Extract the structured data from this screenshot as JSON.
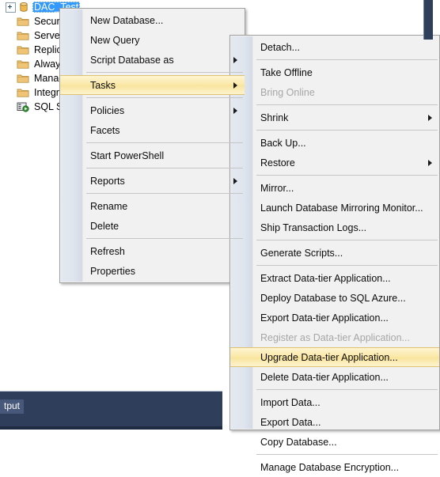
{
  "tree": {
    "items": [
      {
        "label": "DAC_Test",
        "icon": "database-icon",
        "selected": true,
        "expandable": true
      },
      {
        "label": "Security",
        "icon": "folder-icon",
        "selected": false,
        "expandable": false
      },
      {
        "label": "Server Ob",
        "icon": "folder-icon",
        "selected": false,
        "expandable": false
      },
      {
        "label": "Replicatio",
        "icon": "folder-icon",
        "selected": false,
        "expandable": false
      },
      {
        "label": "AlwaysO",
        "icon": "folder-icon",
        "selected": false,
        "expandable": false
      },
      {
        "label": "Manager",
        "icon": "folder-icon",
        "selected": false,
        "expandable": false
      },
      {
        "label": "Integratio",
        "icon": "folder-icon",
        "selected": false,
        "expandable": false
      },
      {
        "label": "SQL Serv",
        "icon": "sql-server-agent-icon",
        "selected": false,
        "expandable": false
      }
    ]
  },
  "context_menu": {
    "items": [
      {
        "type": "item",
        "label": "New Database...",
        "submenu": false,
        "disabled": false,
        "highlighted": false
      },
      {
        "type": "item",
        "label": "New Query",
        "submenu": false,
        "disabled": false,
        "highlighted": false
      },
      {
        "type": "item",
        "label": "Script Database as",
        "submenu": true,
        "disabled": false,
        "highlighted": false
      },
      {
        "type": "separator"
      },
      {
        "type": "item",
        "label": "Tasks",
        "submenu": true,
        "disabled": false,
        "highlighted": true
      },
      {
        "type": "separator"
      },
      {
        "type": "item",
        "label": "Policies",
        "submenu": true,
        "disabled": false,
        "highlighted": false
      },
      {
        "type": "item",
        "label": "Facets",
        "submenu": false,
        "disabled": false,
        "highlighted": false
      },
      {
        "type": "separator"
      },
      {
        "type": "item",
        "label": "Start PowerShell",
        "submenu": false,
        "disabled": false,
        "highlighted": false
      },
      {
        "type": "separator"
      },
      {
        "type": "item",
        "label": "Reports",
        "submenu": true,
        "disabled": false,
        "highlighted": false
      },
      {
        "type": "separator"
      },
      {
        "type": "item",
        "label": "Rename",
        "submenu": false,
        "disabled": false,
        "highlighted": false
      },
      {
        "type": "item",
        "label": "Delete",
        "submenu": false,
        "disabled": false,
        "highlighted": false
      },
      {
        "type": "separator"
      },
      {
        "type": "item",
        "label": "Refresh",
        "submenu": false,
        "disabled": false,
        "highlighted": false
      },
      {
        "type": "item",
        "label": "Properties",
        "submenu": false,
        "disabled": false,
        "highlighted": false
      }
    ]
  },
  "tasks_submenu": {
    "items": [
      {
        "type": "item",
        "label": "Detach...",
        "submenu": false,
        "disabled": false,
        "highlighted": false
      },
      {
        "type": "separator"
      },
      {
        "type": "item",
        "label": "Take Offline",
        "submenu": false,
        "disabled": false,
        "highlighted": false
      },
      {
        "type": "item",
        "label": "Bring Online",
        "submenu": false,
        "disabled": true,
        "highlighted": false
      },
      {
        "type": "separator"
      },
      {
        "type": "item",
        "label": "Shrink",
        "submenu": true,
        "disabled": false,
        "highlighted": false
      },
      {
        "type": "separator"
      },
      {
        "type": "item",
        "label": "Back Up...",
        "submenu": false,
        "disabled": false,
        "highlighted": false
      },
      {
        "type": "item",
        "label": "Restore",
        "submenu": true,
        "disabled": false,
        "highlighted": false
      },
      {
        "type": "separator"
      },
      {
        "type": "item",
        "label": "Mirror...",
        "submenu": false,
        "disabled": false,
        "highlighted": false
      },
      {
        "type": "item",
        "label": "Launch Database Mirroring Monitor...",
        "submenu": false,
        "disabled": false,
        "highlighted": false
      },
      {
        "type": "item",
        "label": "Ship Transaction Logs...",
        "submenu": false,
        "disabled": false,
        "highlighted": false
      },
      {
        "type": "separator"
      },
      {
        "type": "item",
        "label": "Generate Scripts...",
        "submenu": false,
        "disabled": false,
        "highlighted": false
      },
      {
        "type": "separator"
      },
      {
        "type": "item",
        "label": "Extract Data-tier Application...",
        "submenu": false,
        "disabled": false,
        "highlighted": false
      },
      {
        "type": "item",
        "label": "Deploy Database to SQL Azure...",
        "submenu": false,
        "disabled": false,
        "highlighted": false
      },
      {
        "type": "item",
        "label": "Export Data-tier Application...",
        "submenu": false,
        "disabled": false,
        "highlighted": false
      },
      {
        "type": "item",
        "label": "Register as Data-tier Application...",
        "submenu": false,
        "disabled": true,
        "highlighted": false
      },
      {
        "type": "item",
        "label": "Upgrade Data-tier Application...",
        "submenu": false,
        "disabled": false,
        "highlighted": true
      },
      {
        "type": "item",
        "label": "Delete Data-tier Application...",
        "submenu": false,
        "disabled": false,
        "highlighted": false
      },
      {
        "type": "separator"
      },
      {
        "type": "item",
        "label": "Import Data...",
        "submenu": false,
        "disabled": false,
        "highlighted": false
      },
      {
        "type": "item",
        "label": "Export Data...",
        "submenu": false,
        "disabled": false,
        "highlighted": false
      },
      {
        "type": "item",
        "label": "Copy Database...",
        "submenu": false,
        "disabled": false,
        "highlighted": false
      },
      {
        "type": "separator"
      },
      {
        "type": "item",
        "label": "Manage Database Encryption...",
        "submenu": false,
        "disabled": false,
        "highlighted": false
      }
    ]
  },
  "output_panel": {
    "tab_label": "tput"
  },
  "colors": {
    "selection_blue": "#3399ff",
    "highlight_gold": "#fbe9a8",
    "highlight_border": "#e0c273",
    "menu_background": "#f1f1f1",
    "menu_gutter": "#dfe5ee",
    "disabled_text": "#a6a6a6",
    "dock_background": "#2f3e5b",
    "folder_icon": "#e8b35c"
  }
}
